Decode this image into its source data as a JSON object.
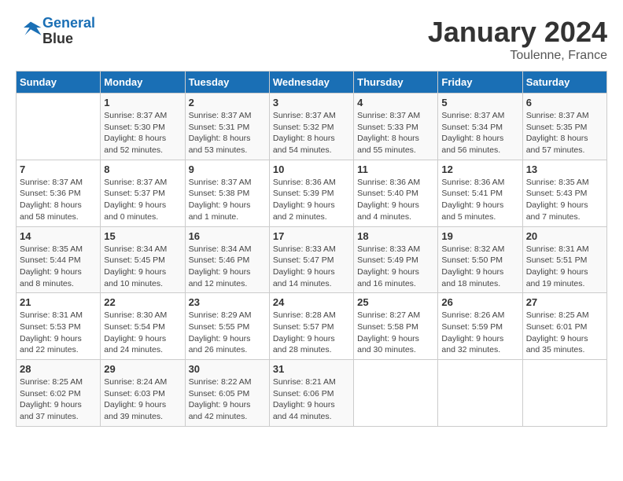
{
  "logo": {
    "line1": "General",
    "line2": "Blue"
  },
  "title": "January 2024",
  "location": "Toulenne, France",
  "days_of_week": [
    "Sunday",
    "Monday",
    "Tuesday",
    "Wednesday",
    "Thursday",
    "Friday",
    "Saturday"
  ],
  "weeks": [
    [
      {
        "day": "",
        "info": ""
      },
      {
        "day": "1",
        "info": "Sunrise: 8:37 AM\nSunset: 5:30 PM\nDaylight: 8 hours\nand 52 minutes."
      },
      {
        "day": "2",
        "info": "Sunrise: 8:37 AM\nSunset: 5:31 PM\nDaylight: 8 hours\nand 53 minutes."
      },
      {
        "day": "3",
        "info": "Sunrise: 8:37 AM\nSunset: 5:32 PM\nDaylight: 8 hours\nand 54 minutes."
      },
      {
        "day": "4",
        "info": "Sunrise: 8:37 AM\nSunset: 5:33 PM\nDaylight: 8 hours\nand 55 minutes."
      },
      {
        "day": "5",
        "info": "Sunrise: 8:37 AM\nSunset: 5:34 PM\nDaylight: 8 hours\nand 56 minutes."
      },
      {
        "day": "6",
        "info": "Sunrise: 8:37 AM\nSunset: 5:35 PM\nDaylight: 8 hours\nand 57 minutes."
      }
    ],
    [
      {
        "day": "7",
        "info": "Sunrise: 8:37 AM\nSunset: 5:36 PM\nDaylight: 8 hours\nand 58 minutes."
      },
      {
        "day": "8",
        "info": "Sunrise: 8:37 AM\nSunset: 5:37 PM\nDaylight: 9 hours\nand 0 minutes."
      },
      {
        "day": "9",
        "info": "Sunrise: 8:37 AM\nSunset: 5:38 PM\nDaylight: 9 hours\nand 1 minute."
      },
      {
        "day": "10",
        "info": "Sunrise: 8:36 AM\nSunset: 5:39 PM\nDaylight: 9 hours\nand 2 minutes."
      },
      {
        "day": "11",
        "info": "Sunrise: 8:36 AM\nSunset: 5:40 PM\nDaylight: 9 hours\nand 4 minutes."
      },
      {
        "day": "12",
        "info": "Sunrise: 8:36 AM\nSunset: 5:41 PM\nDaylight: 9 hours\nand 5 minutes."
      },
      {
        "day": "13",
        "info": "Sunrise: 8:35 AM\nSunset: 5:43 PM\nDaylight: 9 hours\nand 7 minutes."
      }
    ],
    [
      {
        "day": "14",
        "info": "Sunrise: 8:35 AM\nSunset: 5:44 PM\nDaylight: 9 hours\nand 8 minutes."
      },
      {
        "day": "15",
        "info": "Sunrise: 8:34 AM\nSunset: 5:45 PM\nDaylight: 9 hours\nand 10 minutes."
      },
      {
        "day": "16",
        "info": "Sunrise: 8:34 AM\nSunset: 5:46 PM\nDaylight: 9 hours\nand 12 minutes."
      },
      {
        "day": "17",
        "info": "Sunrise: 8:33 AM\nSunset: 5:47 PM\nDaylight: 9 hours\nand 14 minutes."
      },
      {
        "day": "18",
        "info": "Sunrise: 8:33 AM\nSunset: 5:49 PM\nDaylight: 9 hours\nand 16 minutes."
      },
      {
        "day": "19",
        "info": "Sunrise: 8:32 AM\nSunset: 5:50 PM\nDaylight: 9 hours\nand 18 minutes."
      },
      {
        "day": "20",
        "info": "Sunrise: 8:31 AM\nSunset: 5:51 PM\nDaylight: 9 hours\nand 19 minutes."
      }
    ],
    [
      {
        "day": "21",
        "info": "Sunrise: 8:31 AM\nSunset: 5:53 PM\nDaylight: 9 hours\nand 22 minutes."
      },
      {
        "day": "22",
        "info": "Sunrise: 8:30 AM\nSunset: 5:54 PM\nDaylight: 9 hours\nand 24 minutes."
      },
      {
        "day": "23",
        "info": "Sunrise: 8:29 AM\nSunset: 5:55 PM\nDaylight: 9 hours\nand 26 minutes."
      },
      {
        "day": "24",
        "info": "Sunrise: 8:28 AM\nSunset: 5:57 PM\nDaylight: 9 hours\nand 28 minutes."
      },
      {
        "day": "25",
        "info": "Sunrise: 8:27 AM\nSunset: 5:58 PM\nDaylight: 9 hours\nand 30 minutes."
      },
      {
        "day": "26",
        "info": "Sunrise: 8:26 AM\nSunset: 5:59 PM\nDaylight: 9 hours\nand 32 minutes."
      },
      {
        "day": "27",
        "info": "Sunrise: 8:25 AM\nSunset: 6:01 PM\nDaylight: 9 hours\nand 35 minutes."
      }
    ],
    [
      {
        "day": "28",
        "info": "Sunrise: 8:25 AM\nSunset: 6:02 PM\nDaylight: 9 hours\nand 37 minutes."
      },
      {
        "day": "29",
        "info": "Sunrise: 8:24 AM\nSunset: 6:03 PM\nDaylight: 9 hours\nand 39 minutes."
      },
      {
        "day": "30",
        "info": "Sunrise: 8:22 AM\nSunset: 6:05 PM\nDaylight: 9 hours\nand 42 minutes."
      },
      {
        "day": "31",
        "info": "Sunrise: 8:21 AM\nSunset: 6:06 PM\nDaylight: 9 hours\nand 44 minutes."
      },
      {
        "day": "",
        "info": ""
      },
      {
        "day": "",
        "info": ""
      },
      {
        "day": "",
        "info": ""
      }
    ]
  ]
}
